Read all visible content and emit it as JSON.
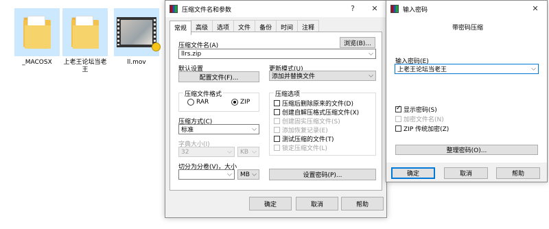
{
  "desktop": {
    "files": [
      {
        "name": "_MACOSX",
        "type": "folder"
      },
      {
        "name": "上老王论坛当老王",
        "type": "folder"
      },
      {
        "name": "ll.mov",
        "type": "video"
      }
    ]
  },
  "archive_dialog": {
    "title": "压缩文件名和参数",
    "help_glyph": "?",
    "close_glyph": "✕",
    "tabs": [
      "常规",
      "高级",
      "选项",
      "文件",
      "备份",
      "时间",
      "注释"
    ],
    "active_tab": "常规",
    "archive_name_label": "压缩文件名(A)",
    "browse_button": "浏览(B)...",
    "archive_name_value": "llrs.zip",
    "default_settings_label": "默认设置",
    "profiles_button": "配置文件(F)...",
    "update_mode_label": "更新模式(U)",
    "update_mode_value": "添加并替换文件",
    "format_group_title": "压缩文件格式",
    "format_options": [
      "RAR",
      "ZIP"
    ],
    "format_selected": "ZIP",
    "method_label": "压缩方式(C)",
    "method_value": "标准",
    "dict_size_label": "字典大小(I)",
    "dict_size_value": "32",
    "dict_unit": "KB",
    "split_label": "切分为分卷(V)，大小",
    "split_value": "",
    "split_unit": "MB",
    "options_group_title": "压缩选项",
    "options": [
      {
        "label": "压缩后删除原来的文件(D)",
        "checked": false,
        "enabled": true
      },
      {
        "label": "创建自解压格式压缩文件(X)",
        "checked": false,
        "enabled": true
      },
      {
        "label": "创建固实压缩文件(S)",
        "checked": false,
        "enabled": false
      },
      {
        "label": "添加恢复记录(E)",
        "checked": false,
        "enabled": false
      },
      {
        "label": "测试压缩的文件(T)",
        "checked": false,
        "enabled": true
      },
      {
        "label": "锁定压缩文件(L)",
        "checked": false,
        "enabled": false
      }
    ],
    "set_password_button": "设置密码(P)...",
    "ok": "确定",
    "cancel": "取消",
    "help": "帮助"
  },
  "password_dialog": {
    "title": "输入密码",
    "close_glyph": "✕",
    "heading": "带密码压缩",
    "password_label": "输入密码(E)",
    "password_value": "上老王论坛当老王",
    "checkboxes": [
      {
        "label": "显示密码(S)",
        "checked": true,
        "enabled": true
      },
      {
        "label": "加密文件名(N)",
        "checked": false,
        "enabled": false
      },
      {
        "label": "ZIP 传统加密(Z)",
        "checked": false,
        "enabled": true
      }
    ],
    "organize_button": "整理密码(O)...",
    "ok": "确定",
    "cancel": "取消",
    "help": "帮助"
  }
}
